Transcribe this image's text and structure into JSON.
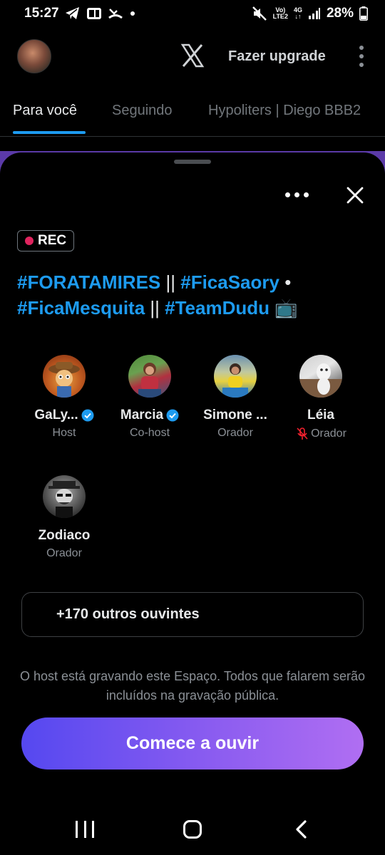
{
  "status_bar": {
    "time": "15:27",
    "network_top": "Vo)",
    "network_bottom": "LTE2",
    "network_4g": "4G",
    "battery": "28%"
  },
  "app_bar": {
    "upgrade_label": "Fazer upgrade",
    "logo_icon": "x-logo-icon"
  },
  "tabs": [
    {
      "label": "Para você",
      "active": true
    },
    {
      "label": "Seguindo",
      "active": false
    },
    {
      "label": "Hypoliters | Diego BBB2",
      "active": false
    }
  ],
  "space": {
    "rec_label": "REC",
    "title_parts": [
      "#FORATAMIRES",
      " || ",
      "#FicaSaory",
      " • ",
      "#FicaMesquita",
      " || ",
      "#TeamDudu",
      " 📺"
    ],
    "participants": [
      {
        "name": "GaLy...",
        "role": "Host",
        "verified": true,
        "muted": false
      },
      {
        "name": "Marcia",
        "role": "Co-host",
        "verified": true,
        "muted": false
      },
      {
        "name": "Simone ...",
        "role": "Orador",
        "verified": false,
        "muted": false
      },
      {
        "name": "Léia",
        "role": "Orador",
        "verified": false,
        "muted": true
      },
      {
        "name": "Zodiaco",
        "role": "Orador",
        "verified": false,
        "muted": false
      }
    ],
    "listeners_label": "+170 outros ouvintes",
    "notice": "O host está gravando este Espaço. Todos que falarem serão incluídos na gravação pública.",
    "start_button": "Comece a ouvir"
  },
  "colors": {
    "accent": "#1d9bf0",
    "rec_dot": "#e0245e",
    "muted_icon": "#f4212e",
    "button_gradient_start": "#5548f0",
    "button_gradient_end": "#b06ef2"
  }
}
